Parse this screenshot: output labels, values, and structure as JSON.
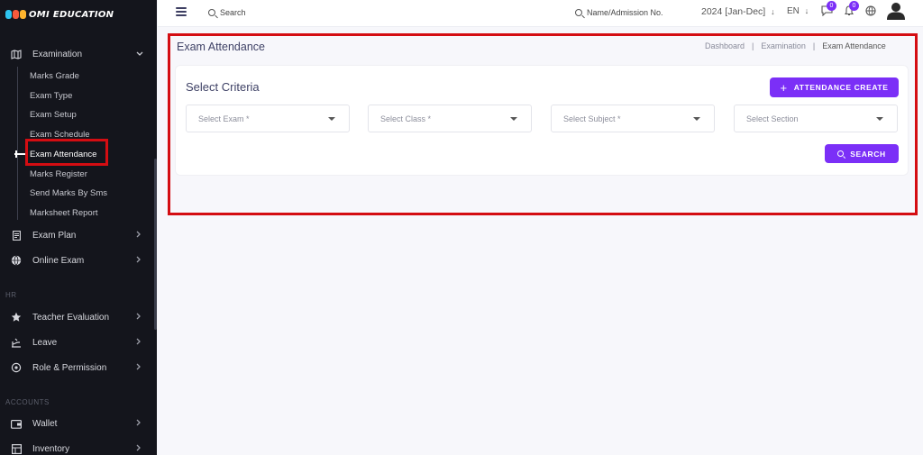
{
  "brand": {
    "logo_text": "OMI EDUCATION",
    "mark_colors": [
      "#2ec4f0",
      "#f55a3c",
      "#ffb52e"
    ]
  },
  "sidebar": {
    "examination": {
      "label": "Examination",
      "icon": "map-icon"
    },
    "submenu": [
      {
        "label": "Marks Grade"
      },
      {
        "label": "Exam Type"
      },
      {
        "label": "Exam Setup"
      },
      {
        "label": "Exam Schedule"
      },
      {
        "label": "Exam Attendance",
        "active": true
      },
      {
        "label": "Marks Register"
      },
      {
        "label": "Send Marks By Sms"
      },
      {
        "label": "Marksheet Report"
      }
    ],
    "items": [
      {
        "label": "Exam Plan",
        "icon": "document-icon"
      },
      {
        "label": "Online Exam",
        "icon": "globe-icon"
      },
      {
        "label": "Teacher Evaluation",
        "icon": "star-icon"
      },
      {
        "label": "Leave",
        "icon": "leave-icon"
      },
      {
        "label": "Role & Permission",
        "icon": "permission-icon"
      },
      {
        "label": "Wallet",
        "icon": "wallet-icon"
      },
      {
        "label": "Inventory",
        "icon": "inventory-icon"
      }
    ],
    "sections": {
      "hr": "HR",
      "accounts": "ACCOUNTS"
    }
  },
  "topbar": {
    "search_label": "Search",
    "admission_label": "Name/Admission No.",
    "session": "2024 [Jan-Dec]",
    "language": "EN",
    "message_count": "0",
    "notification_count": "0"
  },
  "page": {
    "title": "Exam Attendance",
    "breadcrumb": [
      "Dashboard",
      "Examination",
      "Exam Attendance"
    ],
    "breadcrumb_sep": "|"
  },
  "criteria": {
    "title": "Select Criteria",
    "create_button": "ATTENDANCE CREATE",
    "search_button": "SEARCH",
    "selects": [
      {
        "placeholder": "Select Exam *"
      },
      {
        "placeholder": "Select Class *"
      },
      {
        "placeholder": "Select Subject *"
      },
      {
        "placeholder": "Select Section"
      }
    ]
  },
  "colors": {
    "accent": "#7b2ff7",
    "sidebar_bg": "#14151c",
    "highlight": "#d40d12"
  }
}
